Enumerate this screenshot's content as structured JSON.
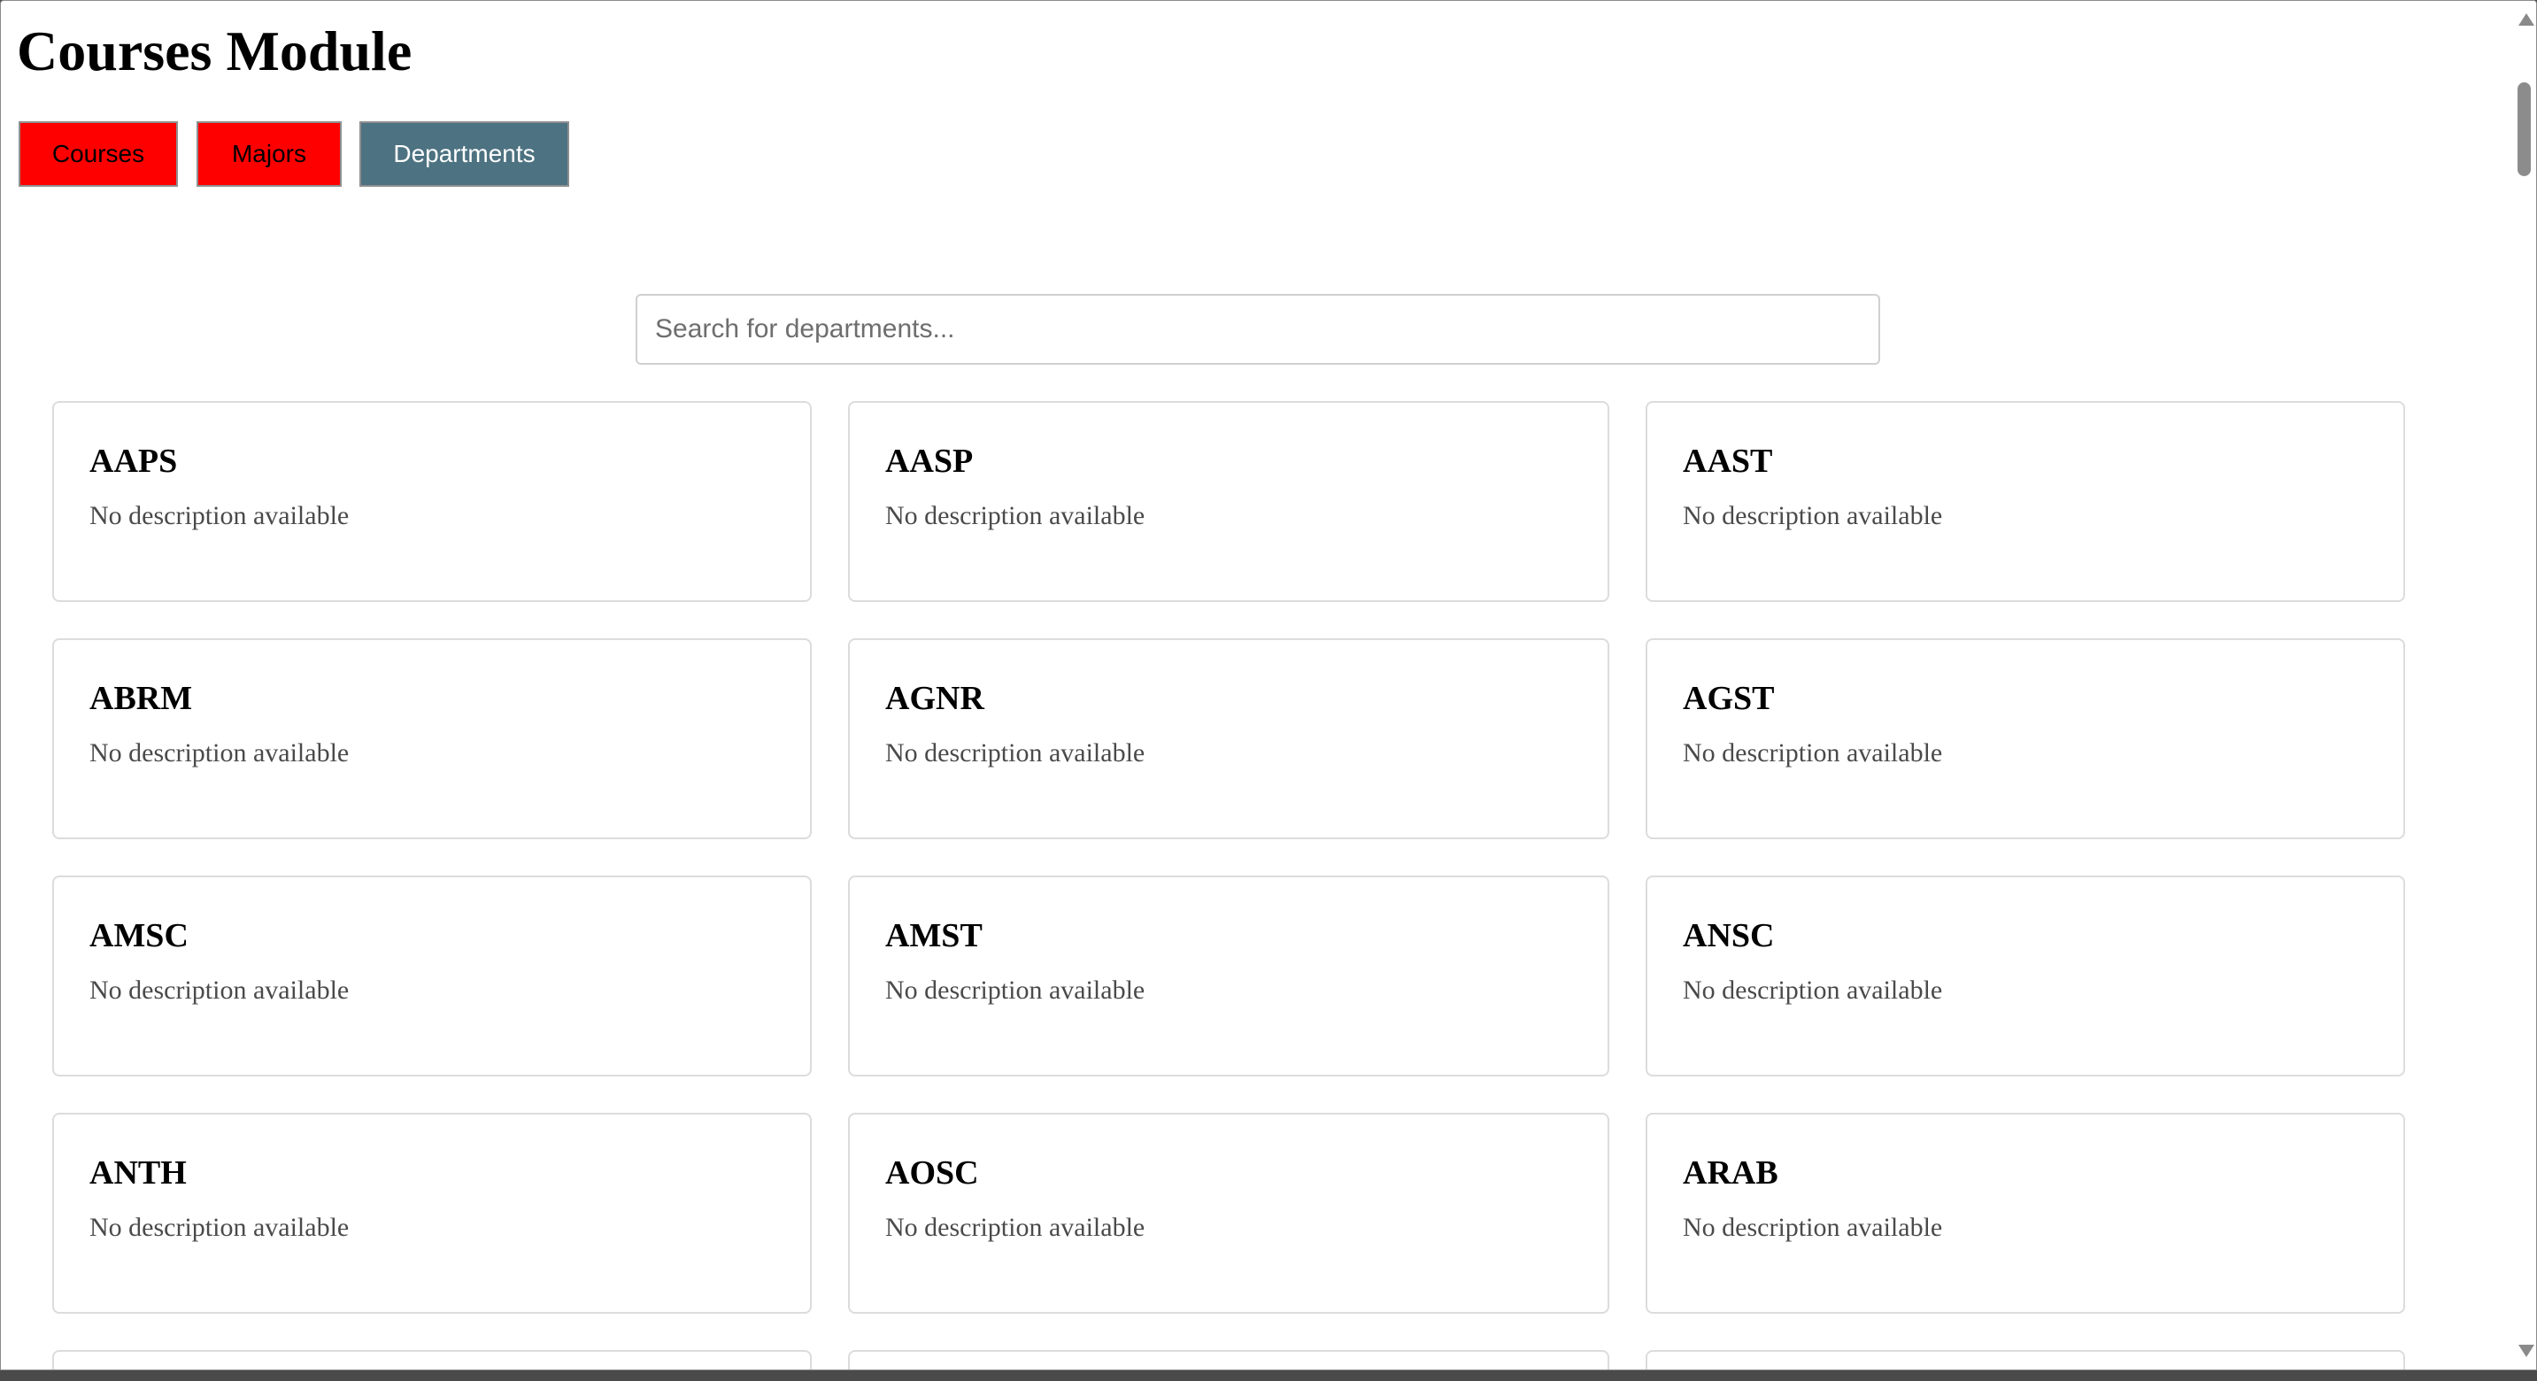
{
  "page": {
    "title": "Courses Module"
  },
  "tabs": [
    {
      "label": "Courses",
      "active": false
    },
    {
      "label": "Majors",
      "active": false
    },
    {
      "label": "Departments",
      "active": true
    }
  ],
  "search": {
    "placeholder": "Search for departments...",
    "value": ""
  },
  "departments": [
    {
      "code": "AAPS",
      "description": "No description available"
    },
    {
      "code": "AASP",
      "description": "No description available"
    },
    {
      "code": "AAST",
      "description": "No description available"
    },
    {
      "code": "ABRM",
      "description": "No description available"
    },
    {
      "code": "AGNR",
      "description": "No description available"
    },
    {
      "code": "AGST",
      "description": "No description available"
    },
    {
      "code": "AMSC",
      "description": "No description available"
    },
    {
      "code": "AMST",
      "description": "No description available"
    },
    {
      "code": "ANSC",
      "description": "No description available"
    },
    {
      "code": "ANTH",
      "description": "No description available"
    },
    {
      "code": "AOSC",
      "description": "No description available"
    },
    {
      "code": "ARAB",
      "description": "No description available"
    }
  ],
  "colors": {
    "tab_inactive": "#ff0000",
    "tab_active": "#4d7281",
    "card_border": "#dcdcdc"
  }
}
